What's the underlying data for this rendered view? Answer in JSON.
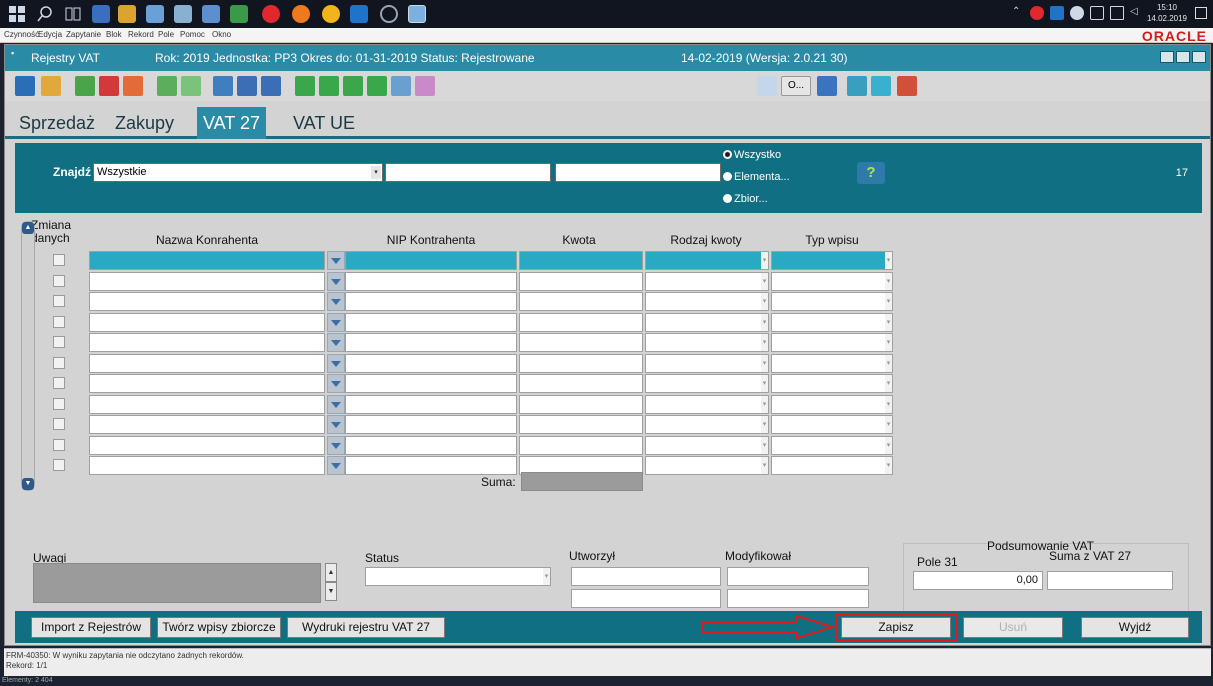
{
  "taskbar": {
    "clock_time": "15:10",
    "clock_date": "14.02.2019",
    "icons": [
      "windows-start-icon",
      "search-icon",
      "task-view-icon",
      "save-app-icon",
      "explorer-app-icon",
      "app-icon-1",
      "app-icon-2",
      "app-icon-3",
      "app-icon-4",
      "opera-icon",
      "firefox-icon",
      "chrome-icon",
      "outlook-icon",
      "app-icon-5",
      "app-icon-6"
    ]
  },
  "menubar": {
    "items": [
      "Czynność",
      "Edycja",
      "Zapytanie",
      "Blok",
      "Rekord",
      "Pole",
      "Pomoc",
      "Okno"
    ],
    "brand": "ORACLE"
  },
  "window": {
    "app_title": "Rejestry VAT",
    "context": "Rok: 2019 Jednostka: PP3 Okres do: 01-31-2019 Status: Rejestrowane",
    "date_version": "14-02-2019  (Wersja: 2.0.21 30)",
    "toolbar_o_label": "O..."
  },
  "tabs": [
    {
      "label": "Sprzedaż",
      "active": false
    },
    {
      "label": "Zakupy",
      "active": false
    },
    {
      "label": "VAT 27",
      "active": true
    },
    {
      "label": "VAT UE",
      "active": false
    }
  ],
  "search": {
    "label": "Znajdź",
    "combo_value": "Wszystkie",
    "radios": [
      {
        "label": "Wszystko",
        "checked": true
      },
      {
        "label": "Elementa...",
        "checked": false
      },
      {
        "label": "Zbior...",
        "checked": false
      }
    ],
    "count": "17"
  },
  "grid": {
    "columns": {
      "zmiana": "Zmiana danych",
      "nazwa": "Nazwa Konrahenta",
      "nip": "NIP Kontrahenta",
      "kwota": "Kwota",
      "rodzaj": "Rodzaj kwoty",
      "typ": "Typ wpisu"
    },
    "row_count": 11,
    "suma_label": "Suma:"
  },
  "form": {
    "uwagi": "Uwagi",
    "status": "Status",
    "utworzyl": "Utworzył",
    "modyfikowal": "Modyfikował",
    "podsumowanie": "Podsumowanie VAT",
    "pole31": "Pole 31",
    "suma_vat27": "Suma z VAT 27",
    "pole31_value": "0,00"
  },
  "actions": {
    "import": "Import z Rejestrów",
    "tworz": "Twórz wpisy zbiorcze",
    "wydruki": "Wydruki rejestru VAT 27",
    "zapisz": "Zapisz",
    "usun": "Usuń",
    "wyjdz": "Wyjdź"
  },
  "status_bar": {
    "message": "FRM-40350: W wyniku zapytania nie odczytano żadnych rekordów.",
    "record": "Rekord: 1/1",
    "elements": "Elementy: 2 404"
  },
  "colors": {
    "accent": "#2a8ba6",
    "band": "#106f82",
    "highlight": "#e0191c"
  }
}
